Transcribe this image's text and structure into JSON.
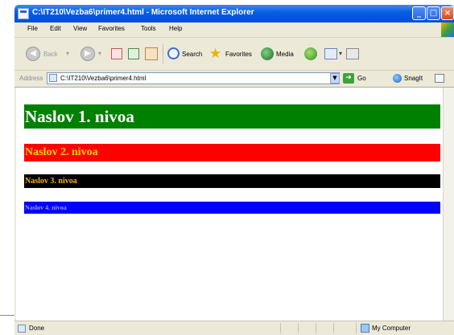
{
  "window": {
    "title": "C:\\IT210\\Vezba6\\primer4.html - Microsoft Internet Explorer",
    "controls": {
      "minimize": "_",
      "maximize": "□",
      "close": "×"
    }
  },
  "menu": [
    "File",
    "Edit",
    "View",
    "Favorites",
    "Tools",
    "Help"
  ],
  "toolbar": {
    "back": "Back",
    "search": "Search",
    "favorites": "Favorites",
    "media": "Media"
  },
  "address": {
    "label": "Address",
    "value": "C:\\IT210\\Vezba6\\primer4.html",
    "go": "Go",
    "snagit": "SnagIt"
  },
  "page": {
    "headings": [
      {
        "level": 1,
        "text": "Naslov 1. nivoa",
        "background": "#008000",
        "color": "#ffffff"
      },
      {
        "level": 2,
        "text": "Naslov 2. nivoa",
        "background": "#ff0000",
        "color": "#ffd700"
      },
      {
        "level": 3,
        "text": "Naslov 3. nivoa",
        "background": "#000000",
        "color": "#f5b21b"
      },
      {
        "level": 4,
        "text": "Naslov 4. nivoa",
        "background": "#0000ff",
        "color": "#9a9ad8"
      }
    ]
  },
  "status": {
    "text": "Done",
    "zone": "My Computer"
  },
  "icons": {
    "app": "ie-page-icon",
    "back": "back-arrow-icon",
    "forward": "forward-arrow-icon",
    "stop": "stop-icon",
    "refresh": "refresh-icon",
    "home": "home-icon",
    "search": "search-icon",
    "favorites": "star-icon",
    "media": "media-icon",
    "history": "history-icon",
    "mail": "mail-icon",
    "print": "print-icon"
  }
}
